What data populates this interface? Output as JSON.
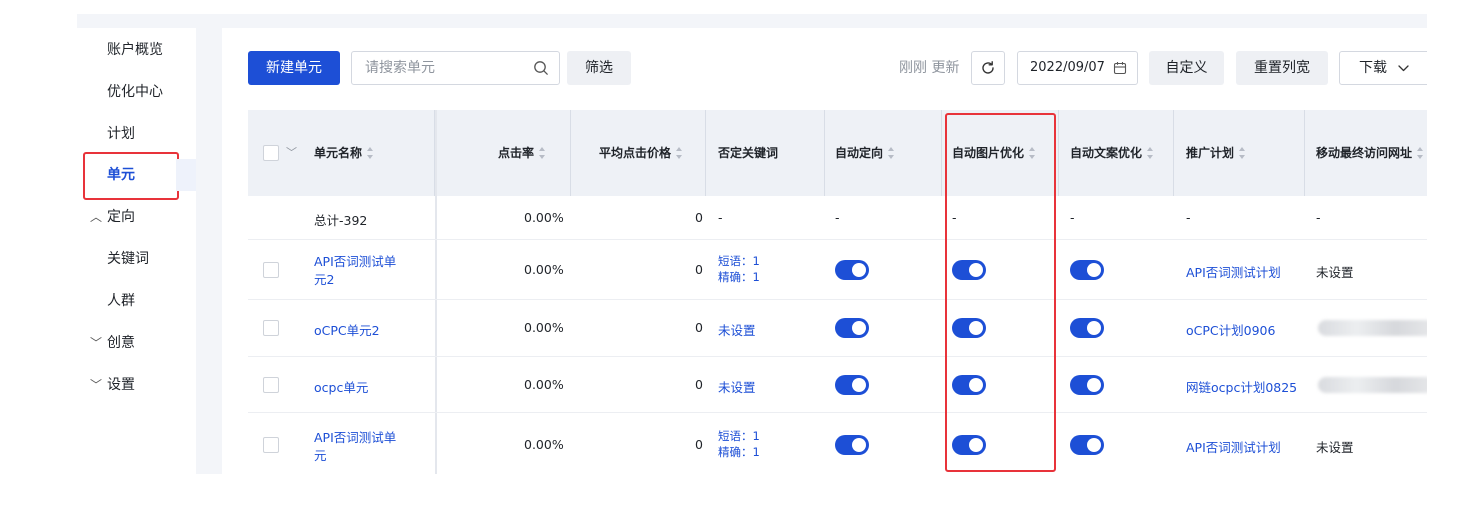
{
  "sidebar": {
    "items": [
      {
        "label": "账户概览"
      },
      {
        "label": "优化中心"
      },
      {
        "label": "计划"
      },
      {
        "label": "单元",
        "active": true
      },
      {
        "label": "定向",
        "expanded": true,
        "chevron": "︿"
      },
      {
        "label": "关键词"
      },
      {
        "label": "人群"
      },
      {
        "label": "创意",
        "expanded": false,
        "chevron": "﹀"
      },
      {
        "label": "设置",
        "expanded": false,
        "chevron": "﹀"
      }
    ]
  },
  "toolbar": {
    "new_label": "新建单元",
    "search_placeholder": "请搜索单元",
    "filter_label": "筛选",
    "refresh_text": "刚刚 更新",
    "date_value": "2022/09/07",
    "customize_label": "自定义",
    "reset_width_label": "重置列宽",
    "download_label": "下载"
  },
  "table": {
    "headers": [
      "单元名称",
      "点击率",
      "平均点击价格",
      "否定关键词",
      "自动定向",
      "自动图片优化",
      "自动文案优化",
      "推广计划",
      "移动最终访问网址"
    ],
    "total_row": {
      "name": "总计-392",
      "ctr": "0.00%",
      "cpc": "0",
      "neg": "-",
      "auto_target": "-",
      "auto_image": "-",
      "auto_copy": "-",
      "plan": "-",
      "url": "-"
    },
    "rows": [
      {
        "name_line1": "API否词测试单",
        "name_line2": "元2",
        "ctr": "0.00%",
        "cpc": "0",
        "neg_line1": "短语：1",
        "neg_line2": "精确：1",
        "auto_target": true,
        "auto_image": true,
        "auto_copy": true,
        "plan": "API否词测试计划",
        "url": "未设置"
      },
      {
        "name_line1": "oCPC单元2",
        "name_line2": "",
        "ctr": "0.00%",
        "cpc": "0",
        "neg_line1": "未设置",
        "neg_line2": "",
        "auto_target": true,
        "auto_image": true,
        "auto_copy": true,
        "plan": "oCPC计划0906",
        "url": ""
      },
      {
        "name_line1": "ocpc单元",
        "name_line2": "",
        "ctr": "0.00%",
        "cpc": "0",
        "neg_line1": "未设置",
        "neg_line2": "",
        "auto_target": true,
        "auto_image": true,
        "auto_copy": true,
        "plan": "网链ocpc计划0825",
        "url": ""
      },
      {
        "name_line1": "API否词测试单",
        "name_line2": "元",
        "ctr": "0.00%",
        "cpc": "0",
        "neg_line1": "短语：1",
        "neg_line2": "精确：1",
        "auto_target": true,
        "auto_image": true,
        "auto_copy": true,
        "plan": "API否词测试计划",
        "url": "未设置"
      }
    ]
  },
  "colors": {
    "accent": "#1d4fd6",
    "highlight": "#e8333a",
    "header_bg": "#eef1f6"
  }
}
